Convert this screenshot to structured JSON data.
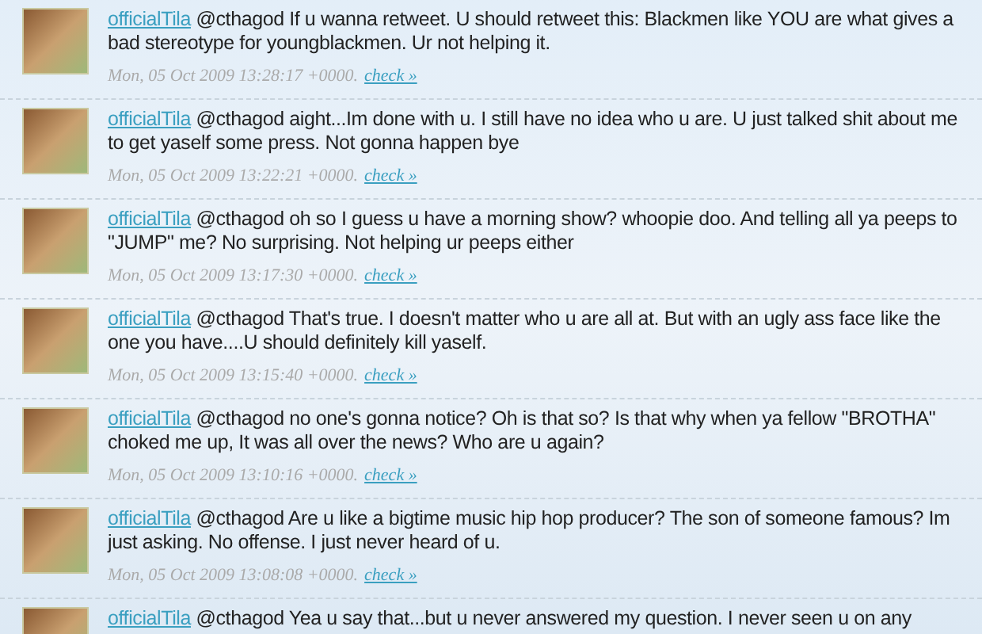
{
  "tweets": [
    {
      "user": "officialTila",
      "text": "@cthagod If u wanna retweet. U should retweet this: Blackmen like YOU are what gives a bad stereotype for youngblackmen. Ur not helping it.",
      "time": "Mon, 05 Oct 2009 13:28:17 +0000.",
      "link": "check »"
    },
    {
      "user": "officialTila",
      "text": "@cthagod aight...Im done with u. I still have no idea who u are. U just talked shit about me to get yaself some press. Not gonna happen bye",
      "time": "Mon, 05 Oct 2009 13:22:21 +0000.",
      "link": "check »"
    },
    {
      "user": "officialTila",
      "text": "@cthagod oh so I guess u have a morning show? whoopie doo. And telling all ya peeps to \"JUMP\" me? No surprising. Not helping ur peeps either",
      "time": "Mon, 05 Oct 2009 13:17:30 +0000.",
      "link": "check »"
    },
    {
      "user": "officialTila",
      "text": "@cthagod That's true. I doesn't matter who u are all at. But with an ugly ass face like the one you have....U should definitely kill yaself.",
      "time": "Mon, 05 Oct 2009 13:15:40 +0000.",
      "link": "check »"
    },
    {
      "user": "officialTila",
      "text": "@cthagod no one's gonna notice? Oh is that so? Is that why when ya fellow \"BROTHA\" choked me up, It was all over the news? Who are u again?",
      "time": "Mon, 05 Oct 2009 13:10:16 +0000.",
      "link": "check »"
    },
    {
      "user": "officialTila",
      "text": "@cthagod Are u like a bigtime music hip hop producer? The son of someone famous? Im just asking. No offense. I just never heard of u.",
      "time": "Mon, 05 Oct 2009 13:08:08 +0000.",
      "link": "check »"
    },
    {
      "user": "officialTila",
      "text": "@cthagod Yea u say that...but u never answered my question. I never seen u on any"
    }
  ]
}
